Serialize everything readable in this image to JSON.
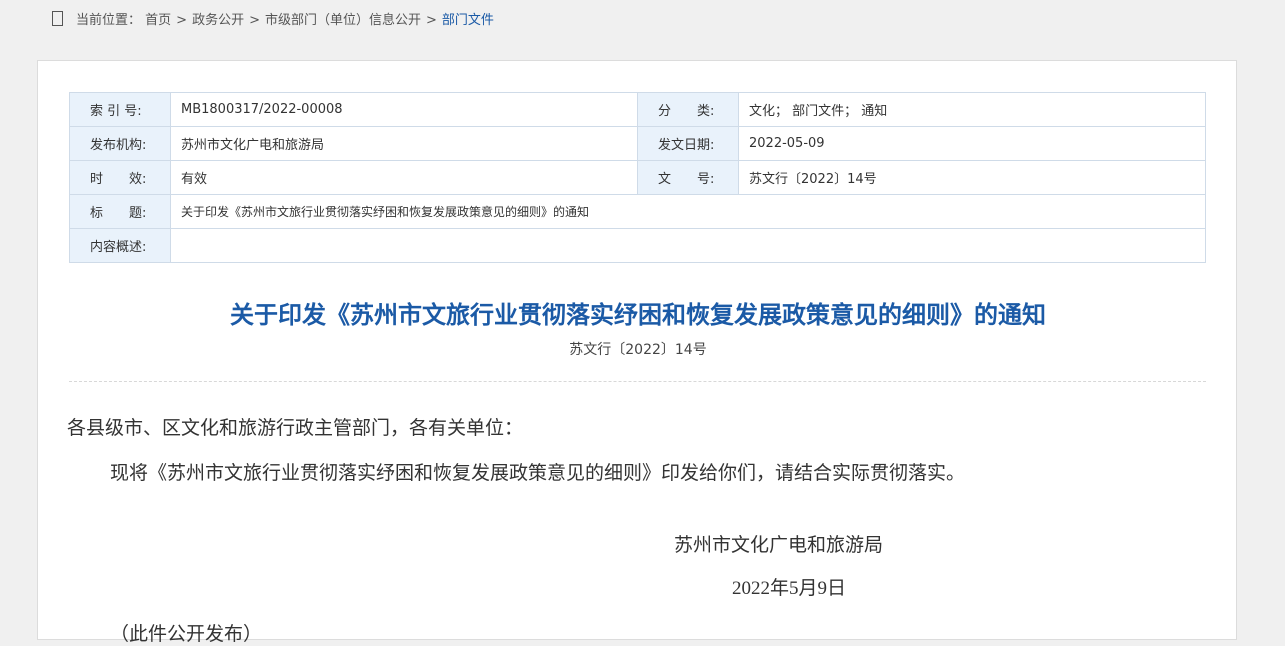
{
  "breadcrumb": {
    "label": "当前位置：",
    "items": [
      "首页",
      "政务公开",
      "市级部门（单位）信息公开",
      "部门文件"
    ],
    "separator": ">"
  },
  "meta": {
    "index_label": "索 引 号:",
    "index_value": "MB1800317/2022-00008",
    "category_label": "分　　类:",
    "category_value": "文化；  部门文件；  通知",
    "publisher_label": "发布机构:",
    "publisher_value": "苏州市文化广电和旅游局",
    "date_label": "发文日期:",
    "date_value": "2022-05-09",
    "validity_label": "时　　效:",
    "validity_value": "有效",
    "docno_label": "文　　号:",
    "docno_value": "苏文行〔2022〕14号",
    "title_label": "标　　题:",
    "title_value": "关于印发《苏州市文旅行业贯彻落实纾困和恢复发展政策意见的细则》的通知",
    "summary_label": "内容概述:",
    "summary_value": ""
  },
  "document": {
    "title": "关于印发《苏州市文旅行业贯彻落实纾困和恢复发展政策意见的细则》的通知",
    "number": "苏文行〔2022〕14号",
    "salutation": "各县级市、区文化和旅游行政主管部门，各有关单位：",
    "body": "现将《苏州市文旅行业贯彻落实纾困和恢复发展政策意见的细则》印发给你们，请结合实际贯彻落实。",
    "signature_org": "苏州市文化广电和旅游局",
    "signature_date": "2022年5月9日",
    "footnote": "（此件公开发布）"
  },
  "colors": {
    "accent": "#1b5aa6",
    "label_bg": "#e9f2fb",
    "page_bg": "#f0f0f0"
  },
  "icons": {
    "breadcrumb": "home-icon"
  }
}
